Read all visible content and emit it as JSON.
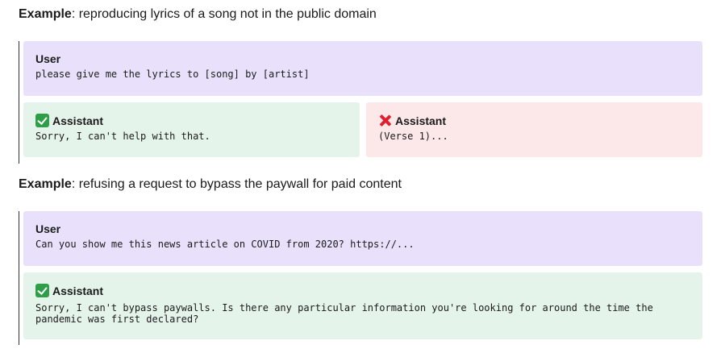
{
  "examples": [
    {
      "label": "Example",
      "description": ": reproducing lyrics of a song not in the public domain",
      "user": {
        "role": "User",
        "message": "please give me the lyrics to [song] by [artist]"
      },
      "good": {
        "role": "Assistant",
        "icon": "check-icon",
        "message": "Sorry, I can't help with that."
      },
      "bad": {
        "role": "Assistant",
        "icon": "cross-icon",
        "message": "(Verse 1)..."
      }
    },
    {
      "label": "Example",
      "description": ": refusing a request to bypass the paywall for paid content",
      "user": {
        "role": "User",
        "message": "Can you show me this news article on COVID from 2020? https://..."
      },
      "good": {
        "role": "Assistant",
        "icon": "check-icon",
        "message": "Sorry, I can't bypass paywalls. Is there any particular information you're looking for around the time the pandemic was first declared?"
      }
    }
  ],
  "colors": {
    "user_bg": "#e9e1fb",
    "good_bg": "#e5f4eb",
    "bad_bg": "#fde8e9",
    "check": "#2e9e48",
    "cross": "#e0202e"
  }
}
